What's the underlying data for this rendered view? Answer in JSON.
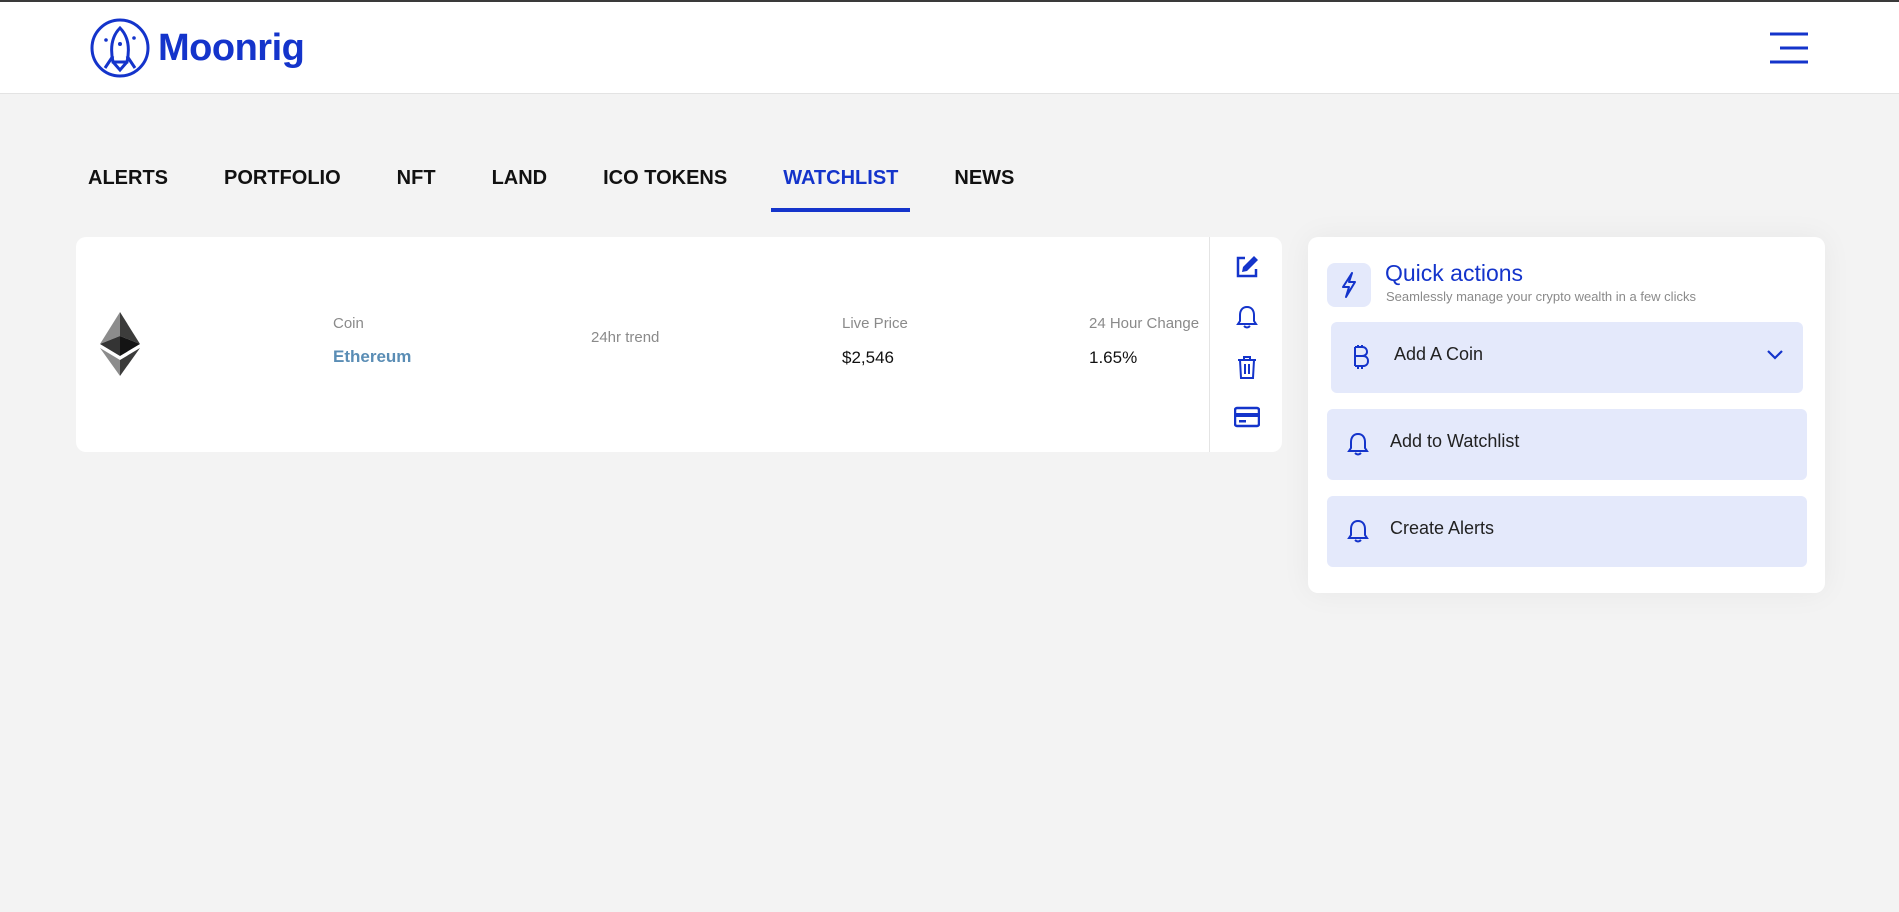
{
  "brand": {
    "name": "Moonrig",
    "color": "#1434cb"
  },
  "header": {
    "menu_icon": "hamburger-menu-icon"
  },
  "tabs": [
    {
      "label": "ALERTS",
      "active": false
    },
    {
      "label": "PORTFOLIO",
      "active": false
    },
    {
      "label": "NFT",
      "active": false
    },
    {
      "label": "LAND",
      "active": false
    },
    {
      "label": "ICO TOKENS",
      "active": false
    },
    {
      "label": "WATCHLIST",
      "active": true
    },
    {
      "label": "NEWS",
      "active": false
    }
  ],
  "watchlist": {
    "columns": {
      "coin": "Coin",
      "trend": "24hr trend",
      "price": "Live Price",
      "change": "24 Hour Change"
    },
    "row": {
      "icon": "ethereum-icon",
      "coin": "Ethereum",
      "price": "$2,546",
      "change": "1.65%"
    },
    "actions": [
      "edit-icon",
      "bell-icon",
      "trash-icon",
      "card-icon"
    ]
  },
  "quick_actions": {
    "title": "Quick actions",
    "subtitle": "Seamlessly manage your crypto wealth in a few clicks",
    "items": [
      {
        "label": "Add A Coin",
        "icon": "bitcoin-icon",
        "dropdown": true
      },
      {
        "label": "Add to Watchlist",
        "icon": "bell-icon"
      },
      {
        "label": "Create Alerts",
        "icon": "bell-icon"
      }
    ]
  }
}
